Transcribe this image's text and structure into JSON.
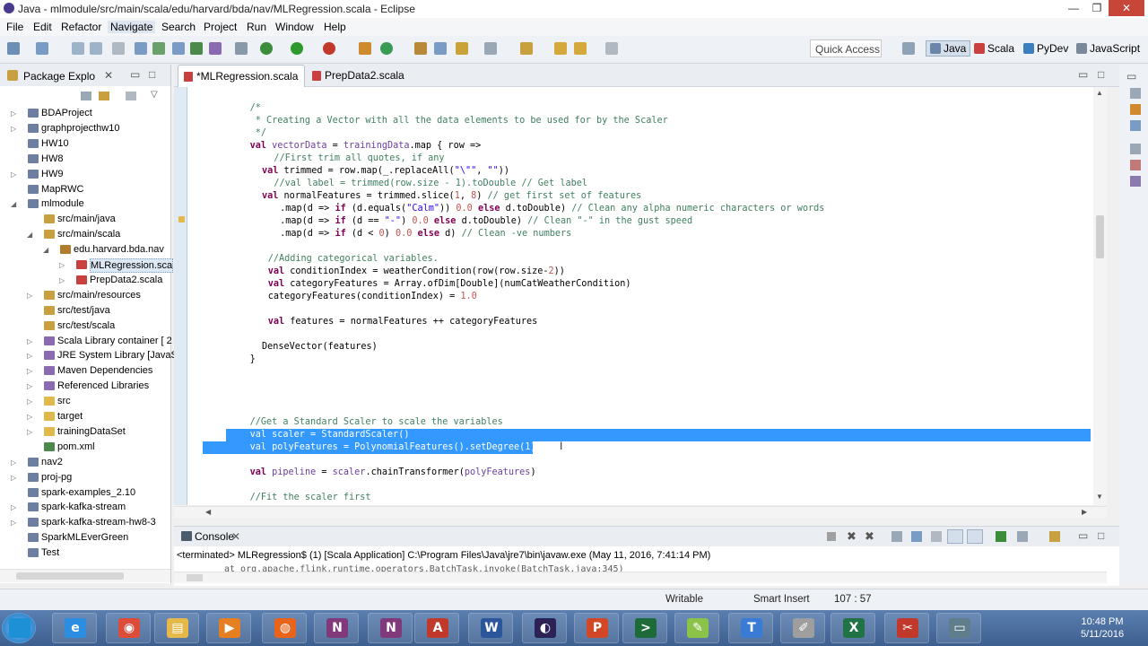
{
  "window": {
    "title": "Java - mlmodule/src/main/scala/edu/harvard/bda/nav/MLRegression.scala - Eclipse",
    "controls": {
      "minimize": "—",
      "maximize": "❐",
      "close": "✕"
    }
  },
  "menu": [
    "File",
    "Edit",
    "Refactor",
    "Navigate",
    "Search",
    "Project",
    "Run",
    "Window",
    "Help"
  ],
  "toolbar": {
    "quick_access": "Quick Access",
    "perspectives": [
      "Java",
      "Scala",
      "PyDev",
      "JavaScript"
    ]
  },
  "package_explorer": {
    "title": "Package Explo",
    "items": [
      {
        "label": "BDAProject",
        "icon": "project-icon",
        "indent": 0,
        "arrow": "▷"
      },
      {
        "label": "graphprojecthw10",
        "icon": "project-icon",
        "indent": 0,
        "arrow": "▷"
      },
      {
        "label": "HW10",
        "icon": "project-icon",
        "indent": 0,
        "arrow": ""
      },
      {
        "label": "HW8",
        "icon": "project-icon",
        "indent": 0,
        "arrow": ""
      },
      {
        "label": "HW9",
        "icon": "project-icon",
        "indent": 0,
        "arrow": "▷"
      },
      {
        "label": "MapRWC",
        "icon": "project-icon",
        "indent": 0,
        "arrow": ""
      },
      {
        "label": "mlmodule",
        "icon": "project-icon",
        "indent": 0,
        "arrow": "◢"
      },
      {
        "label": "src/main/java",
        "icon": "source-folder-icon",
        "indent": 1,
        "arrow": ""
      },
      {
        "label": "src/main/scala",
        "icon": "source-folder-icon",
        "indent": 1,
        "arrow": "◢"
      },
      {
        "label": "edu.harvard.bda.nav",
        "icon": "package-icon",
        "indent": 2,
        "arrow": "◢"
      },
      {
        "label": "MLRegression.sca",
        "icon": "scala-file-icon",
        "indent": 3,
        "arrow": "▷",
        "selected": true
      },
      {
        "label": "PrepData2.scala",
        "icon": "scala-file-icon",
        "indent": 3,
        "arrow": "▷"
      },
      {
        "label": "src/main/resources",
        "icon": "source-folder-icon",
        "indent": 1,
        "arrow": "▷"
      },
      {
        "label": "src/test/java",
        "icon": "source-folder-icon",
        "indent": 1,
        "arrow": ""
      },
      {
        "label": "src/test/scala",
        "icon": "source-folder-icon",
        "indent": 1,
        "arrow": ""
      },
      {
        "label": "Scala Library container [ 2",
        "icon": "library-icon",
        "indent": 1,
        "arrow": "▷"
      },
      {
        "label": "JRE System Library [JavaS",
        "icon": "library-icon",
        "indent": 1,
        "arrow": "▷"
      },
      {
        "label": "Maven Dependencies",
        "icon": "library-icon",
        "indent": 1,
        "arrow": "▷"
      },
      {
        "label": "Referenced Libraries",
        "icon": "library-icon",
        "indent": 1,
        "arrow": "▷"
      },
      {
        "label": "src",
        "icon": "folder-icon",
        "indent": 1,
        "arrow": "▷"
      },
      {
        "label": "target",
        "icon": "folder-icon",
        "indent": 1,
        "arrow": "▷"
      },
      {
        "label": "trainingDataSet",
        "icon": "folder-icon",
        "indent": 1,
        "arrow": "▷"
      },
      {
        "label": "pom.xml",
        "icon": "xml-file-icon",
        "indent": 1,
        "arrow": ""
      },
      {
        "label": "nav2",
        "icon": "project-icon",
        "indent": 0,
        "arrow": "▷"
      },
      {
        "label": "proj-pg",
        "icon": "project-icon",
        "indent": 0,
        "arrow": "▷"
      },
      {
        "label": "spark-examples_2.10",
        "icon": "project-icon",
        "indent": 0,
        "arrow": ""
      },
      {
        "label": "spark-kafka-stream",
        "icon": "project-icon",
        "indent": 0,
        "arrow": "▷"
      },
      {
        "label": "spark-kafka-stream-hw8-3",
        "icon": "project-icon",
        "indent": 0,
        "arrow": "▷"
      },
      {
        "label": "SparkMLEverGreen",
        "icon": "project-icon",
        "indent": 0,
        "arrow": ""
      },
      {
        "label": "Test",
        "icon": "project-icon",
        "indent": 0,
        "arrow": ""
      }
    ]
  },
  "editor": {
    "tabs": [
      {
        "label": "*MLRegression.scala",
        "active": true
      },
      {
        "label": "PrepData2.scala",
        "active": false
      }
    ],
    "lines": [
      {
        "indent": 8,
        "parts": [
          {
            "t": "/*",
            "c": "comment"
          }
        ]
      },
      {
        "indent": 8,
        "parts": [
          {
            "t": " * Creating a Vector with all the data elements to be used for by the Scaler",
            "c": "comment"
          }
        ]
      },
      {
        "indent": 8,
        "parts": [
          {
            "t": " */",
            "c": "comment"
          }
        ]
      },
      {
        "indent": 8,
        "parts": [
          {
            "t": "val ",
            "c": "kw"
          },
          {
            "t": "vectorData",
            "c": "var"
          },
          {
            "t": " = ",
            "c": "plain"
          },
          {
            "t": "trainingData",
            "c": "var"
          },
          {
            "t": ".map { row =>",
            "c": "plain"
          }
        ]
      },
      {
        "indent": 12,
        "parts": [
          {
            "t": "//First trim all quotes, if any",
            "c": "comment"
          }
        ]
      },
      {
        "indent": 10,
        "parts": [
          {
            "t": "val ",
            "c": "kw"
          },
          {
            "t": "trimmed = row.map(_.replaceAll(",
            "c": "plain"
          },
          {
            "t": "\"\\\"\"",
            "c": "str"
          },
          {
            "t": ", ",
            "c": "plain"
          },
          {
            "t": "\"\"",
            "c": "str"
          },
          {
            "t": "))",
            "c": "plain"
          }
        ]
      },
      {
        "indent": 12,
        "parts": [
          {
            "t": "//val label = trimmed(row.size - 1).toDouble // Get label",
            "c": "comment"
          }
        ]
      },
      {
        "indent": 10,
        "parts": [
          {
            "t": "val ",
            "c": "kw"
          },
          {
            "t": "normalFeatures = trimmed.slice(",
            "c": "plain"
          },
          {
            "t": "1",
            "c": "num"
          },
          {
            "t": ", ",
            "c": "plain"
          },
          {
            "t": "8",
            "c": "num"
          },
          {
            "t": ") ",
            "c": "plain"
          },
          {
            "t": "// get first set of features",
            "c": "comment"
          }
        ]
      },
      {
        "indent": 13,
        "parts": [
          {
            "t": ".map(d => ",
            "c": "plain"
          },
          {
            "t": "if ",
            "c": "kw"
          },
          {
            "t": "(d.equals(",
            "c": "plain"
          },
          {
            "t": "\"Calm\"",
            "c": "str"
          },
          {
            "t": ")) ",
            "c": "plain"
          },
          {
            "t": "0.0 ",
            "c": "num"
          },
          {
            "t": "else ",
            "c": "kw"
          },
          {
            "t": "d.toDouble) ",
            "c": "plain"
          },
          {
            "t": "// Clean any alpha numeric characters or words",
            "c": "comment"
          }
        ]
      },
      {
        "indent": 13,
        "parts": [
          {
            "t": ".map(d => ",
            "c": "plain"
          },
          {
            "t": "if ",
            "c": "kw"
          },
          {
            "t": "(d == ",
            "c": "plain"
          },
          {
            "t": "\"-\"",
            "c": "str"
          },
          {
            "t": ") ",
            "c": "plain"
          },
          {
            "t": "0.0 ",
            "c": "num"
          },
          {
            "t": "else ",
            "c": "kw"
          },
          {
            "t": "d.toDouble) ",
            "c": "plain"
          },
          {
            "t": "// Clean \"-\" in the gust speed",
            "c": "comment"
          }
        ]
      },
      {
        "indent": 13,
        "parts": [
          {
            "t": ".map(d => ",
            "c": "plain"
          },
          {
            "t": "if ",
            "c": "kw"
          },
          {
            "t": "(d < ",
            "c": "plain"
          },
          {
            "t": "0",
            "c": "num"
          },
          {
            "t": ") ",
            "c": "plain"
          },
          {
            "t": "0.0 ",
            "c": "num"
          },
          {
            "t": "else ",
            "c": "kw"
          },
          {
            "t": "d) ",
            "c": "plain"
          },
          {
            "t": "// Clean -ve numbers",
            "c": "comment"
          }
        ]
      },
      {
        "indent": 0,
        "parts": []
      },
      {
        "indent": 11,
        "parts": [
          {
            "t": "//Adding categorical variables.",
            "c": "comment"
          }
        ]
      },
      {
        "indent": 11,
        "parts": [
          {
            "t": "val ",
            "c": "kw"
          },
          {
            "t": "conditionIndex = weatherCondition(row(row.size-",
            "c": "plain"
          },
          {
            "t": "2",
            "c": "num"
          },
          {
            "t": "))",
            "c": "plain"
          }
        ]
      },
      {
        "indent": 11,
        "parts": [
          {
            "t": "val ",
            "c": "kw"
          },
          {
            "t": "categoryFeatures = Array.ofDim[Double](numCatWeatherCondition)",
            "c": "plain"
          }
        ]
      },
      {
        "indent": 11,
        "parts": [
          {
            "t": "categoryFeatures(conditionIndex) = ",
            "c": "plain"
          },
          {
            "t": "1.0",
            "c": "num"
          }
        ]
      },
      {
        "indent": 0,
        "parts": []
      },
      {
        "indent": 11,
        "parts": [
          {
            "t": "val ",
            "c": "kw"
          },
          {
            "t": "features = normalFeatures ++ categoryFeatures",
            "c": "plain"
          }
        ]
      },
      {
        "indent": 0,
        "parts": []
      },
      {
        "indent": 10,
        "parts": [
          {
            "t": "DenseVector(features)",
            "c": "plain"
          }
        ]
      },
      {
        "indent": 8,
        "parts": [
          {
            "t": "}",
            "c": "plain"
          }
        ]
      },
      {
        "indent": 0,
        "parts": []
      },
      {
        "indent": 0,
        "parts": []
      },
      {
        "indent": 0,
        "parts": []
      },
      {
        "indent": 0,
        "parts": []
      },
      {
        "indent": 8,
        "parts": [
          {
            "t": "//Get a Standard Scaler to scale the variables",
            "c": "comment"
          }
        ]
      },
      {
        "indent": 8,
        "selected": true,
        "parts": [
          {
            "t": "val scaler = StandardScaler()",
            "c": "plain"
          }
        ]
      },
      {
        "indent": 8,
        "selected": true,
        "parts": [
          {
            "t": "val polyFeatures = PolynomialFeatures().setDegree(1)",
            "c": "plain"
          }
        ]
      },
      {
        "indent": 0,
        "parts": []
      },
      {
        "indent": 8,
        "parts": [
          {
            "t": "val ",
            "c": "kw"
          },
          {
            "t": "pipeline",
            "c": "var"
          },
          {
            "t": " = ",
            "c": "plain"
          },
          {
            "t": "scaler",
            "c": "var"
          },
          {
            "t": ".chainTransformer(",
            "c": "plain"
          },
          {
            "t": "polyFeatures",
            "c": "var"
          },
          {
            "t": ")",
            "c": "plain"
          }
        ]
      },
      {
        "indent": 0,
        "parts": []
      },
      {
        "indent": 8,
        "parts": [
          {
            "t": "//Fit the scaler first",
            "c": "comment"
          }
        ]
      }
    ]
  },
  "console": {
    "title": "Console",
    "terminated": "<terminated> MLRegression$ (1) [Scala Application] C:\\Program Files\\Java\\jre7\\bin\\javaw.exe (May 11, 2016, 7:41:14 PM)",
    "output_line": "at org.apache.flink.runtime.operators.BatchTask.invoke(BatchTask.java:345)"
  },
  "status": {
    "writable": "Writable",
    "insert_mode": "Smart Insert",
    "position": "107 : 57"
  },
  "taskbar": {
    "apps": [
      {
        "name": "windows-start-icon",
        "glyph": "",
        "color": "#1e90d6"
      },
      {
        "name": "internet-explorer-icon",
        "glyph": "e",
        "color": "#2b8ee0"
      },
      {
        "name": "chrome-icon",
        "glyph": "◉",
        "color": "#dd4b39"
      },
      {
        "name": "file-explorer-icon",
        "glyph": "▤",
        "color": "#e5b84a"
      },
      {
        "name": "media-player-icon",
        "glyph": "▶",
        "color": "#e67e22"
      },
      {
        "name": "firefox-icon",
        "glyph": "◍",
        "color": "#e8641b"
      },
      {
        "name": "onenote-icon",
        "glyph": "N",
        "color": "#80397b"
      },
      {
        "name": "onenote-2-icon",
        "glyph": "N",
        "color": "#80397b"
      },
      {
        "name": "acrobat-icon",
        "glyph": "A",
        "color": "#c0392b"
      },
      {
        "name": "word-icon",
        "glyph": "W",
        "color": "#2b579a"
      },
      {
        "name": "eclipse-icon",
        "glyph": "◐",
        "color": "#2c2255"
      },
      {
        "name": "powerpoint-icon",
        "glyph": "P",
        "color": "#d24726"
      },
      {
        "name": "terminal-icon",
        "glyph": ">",
        "color": "#1e6b3a"
      },
      {
        "name": "notepad-icon",
        "glyph": "✎",
        "color": "#8bc34a"
      },
      {
        "name": "text-editor-icon",
        "glyph": "T",
        "color": "#3a7bd5"
      },
      {
        "name": "notes-icon",
        "glyph": "✐",
        "color": "#9e9e9e"
      },
      {
        "name": "excel-icon",
        "glyph": "X",
        "color": "#217346"
      },
      {
        "name": "snipping-tool-icon",
        "glyph": "✂",
        "color": "#c0392b"
      },
      {
        "name": "window-icon",
        "glyph": "▭",
        "color": "#607d8b"
      }
    ],
    "time": "10:48 PM",
    "date": "5/11/2016"
  },
  "colors": {
    "keyword": "#7f0055",
    "comment": "#3f7f5f",
    "string": "#2a00ff",
    "number": "#c75450",
    "var": "#6a3e9e",
    "selection": "#3399ff"
  }
}
